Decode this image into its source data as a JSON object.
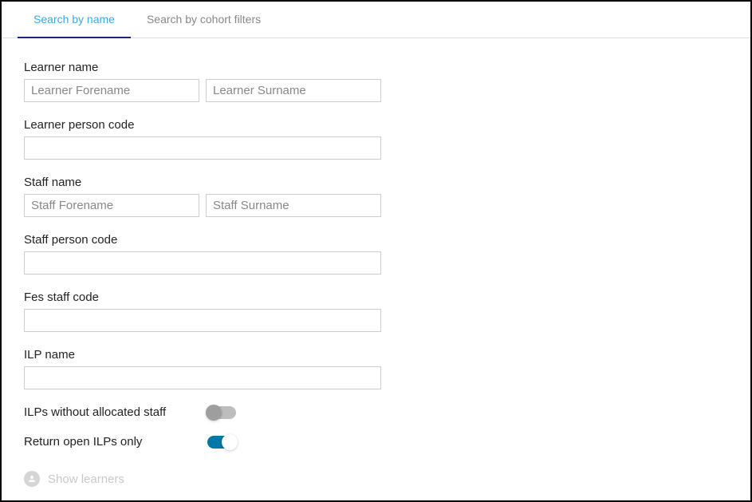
{
  "tabs": {
    "search_by_name": "Search by name",
    "search_by_cohort_filters": "Search by cohort filters"
  },
  "form": {
    "learner_name": {
      "label": "Learner name",
      "forename_placeholder": "Learner Forename",
      "forename_value": "",
      "surname_placeholder": "Learner Surname",
      "surname_value": ""
    },
    "learner_person_code": {
      "label": "Learner person code",
      "value": ""
    },
    "staff_name": {
      "label": "Staff name",
      "forename_placeholder": "Staff Forename",
      "forename_value": "",
      "surname_placeholder": "Staff Surname",
      "surname_value": ""
    },
    "staff_person_code": {
      "label": "Staff person code",
      "value": ""
    },
    "fes_staff_code": {
      "label": "Fes staff code",
      "value": ""
    },
    "ilp_name": {
      "label": "ILP name",
      "value": ""
    },
    "ilps_without_staff": {
      "label": "ILPs without allocated staff",
      "value": false
    },
    "return_open_ilps": {
      "label": "Return open ILPs only",
      "value": true
    }
  },
  "actions": {
    "show_learners": "Show learners"
  }
}
